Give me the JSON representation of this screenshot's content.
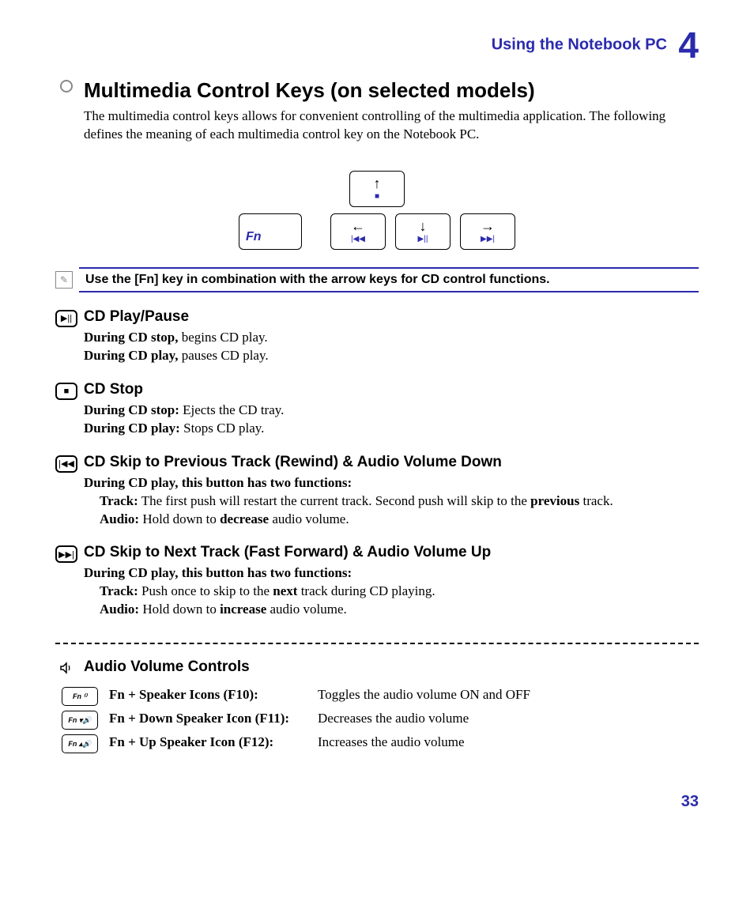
{
  "header": {
    "section_label": "Using the Notebook PC",
    "chapter_number": "4"
  },
  "title": "Multimedia Control Keys (on selected models)",
  "intro": "The multimedia control keys allows for convenient controlling of the multimedia application. The following defines the meaning of each multimedia control key on the Notebook PC.",
  "keys": {
    "fn": "Fn",
    "up_media": "■",
    "left_media": "|◀◀",
    "down_media": "▶||",
    "right_media": "▶▶|"
  },
  "note": "Use the [Fn] key in combination with the arrow keys for CD control functions.",
  "sections": {
    "play": {
      "title": "CD Play/Pause",
      "l1b": "During CD stop,",
      "l1": " begins CD play.",
      "l2b": "During CD play,",
      "l2": " pauses CD play."
    },
    "stop": {
      "title": "CD Stop",
      "l1b": "During CD stop:",
      "l1": " Ejects the CD tray.",
      "l2b": "During CD play:",
      "l2": " Stops CD play."
    },
    "prev": {
      "title": "CD Skip to Previous Track (Rewind) & Audio Volume Down",
      "intro": "During CD play, this button has two functions:",
      "track_b": "Track:",
      "track_1": " The first push will restart the current track. Second push will skip to the ",
      "track_kw": "previous",
      "track_2": " track.",
      "audio_b": "Audio:",
      "audio_1": " Hold down to ",
      "audio_kw": "decrease",
      "audio_2": " audio volume."
    },
    "next": {
      "title": "CD Skip to Next Track (Fast Forward) & Audio Volume Up",
      "intro": "During CD play, this button has two functions:",
      "track_b": "Track:",
      "track_1": " Push once to skip to the ",
      "track_kw": "next",
      "track_2": " track during CD playing.",
      "audio_b": "Audio:",
      "audio_1": " Hold down to ",
      "audio_kw": "increase",
      "audio_2": " audio volume."
    }
  },
  "audio": {
    "title": "Audio Volume Controls",
    "rows": [
      {
        "icon": "Fn ⁽⁾",
        "label": "Fn + Speaker Icons (F10):",
        "desc": "Toggles the audio volume ON and OFF"
      },
      {
        "icon": "Fn ▾🔊",
        "label": "Fn + Down Speaker Icon (F11):",
        "desc": "Decreases the audio volume"
      },
      {
        "icon": "Fn ▴🔊",
        "label": "Fn + Up Speaker Icon (F12):",
        "desc": "Increases the audio volume"
      }
    ]
  },
  "page": "33"
}
